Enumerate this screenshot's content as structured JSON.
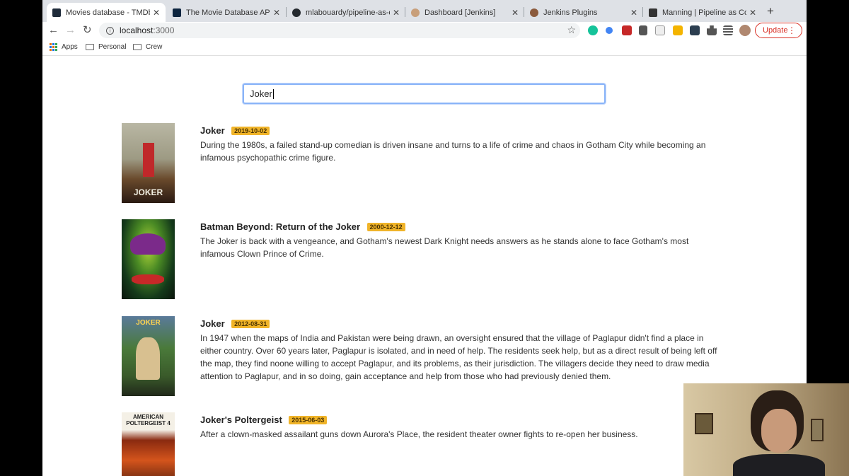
{
  "browser": {
    "tabs": [
      {
        "title": "Movies database - TMDb",
        "favicon_color": "#1f2b3a",
        "active": true
      },
      {
        "title": "The Movie Database API",
        "favicon_color": "#0d253f",
        "active": false
      },
      {
        "title": "mlabouardy/pipeline-as-code",
        "favicon_color": "#24292e",
        "active": false
      },
      {
        "title": "Dashboard [Jenkins]",
        "favicon_color": "#c89f7a",
        "active": false
      },
      {
        "title": "Jenkins Plugins",
        "favicon_color": "#8b5a3c",
        "active": false
      },
      {
        "title": "Manning | Pipeline as Code",
        "favicon_color": "#333333",
        "active": false
      }
    ],
    "url_host": "localhost",
    "url_port": ":3000",
    "update_label": "Update",
    "bookmarks": {
      "apps": "Apps",
      "items": [
        "Personal",
        "Crew"
      ]
    }
  },
  "search": {
    "value": "Joker"
  },
  "movies": [
    {
      "title": "Joker",
      "release_date": "2019-10-02",
      "overview": "During the 1980s, a failed stand-up comedian is driven insane and turns to a life of crime and chaos in Gotham City while becoming an infamous psychopathic crime figure.",
      "poster_text": "JOKER"
    },
    {
      "title": "Batman Beyond: Return of the Joker",
      "release_date": "2000-12-12",
      "overview": "The Joker is back with a vengeance, and Gotham's newest Dark Knight needs answers as he stands alone to face Gotham's most infamous Clown Prince of Crime.",
      "poster_text": ""
    },
    {
      "title": "Joker",
      "release_date": "2012-08-31",
      "overview": "In 1947 when the maps of India and Pakistan were being drawn, an oversight ensured that the village of Paglapur didn't find a place in either country. Over 60 years later, Paglapur is isolated, and in need of help. The residents seek help, but as a direct result of being left off the map, they find noone willing to accept Paglapur, and its problems, as their jurisdiction. The villagers decide they need to draw media attention to Paglapur, and in so doing, gain acceptance and help from those who had previously denied them.",
      "poster_text": "JOKER"
    },
    {
      "title": "Joker's Poltergeist",
      "release_date": "2015-06-03",
      "overview": "After a clown-masked assailant guns down Aurora's Place, the resident theater owner fights to re-open her business.",
      "poster_text": "AMERICAN POLTERGEIST 4"
    }
  ],
  "colors": {
    "date_badge": "#f0b429",
    "search_focus": "#8ab4f8",
    "update": "#d93025"
  }
}
